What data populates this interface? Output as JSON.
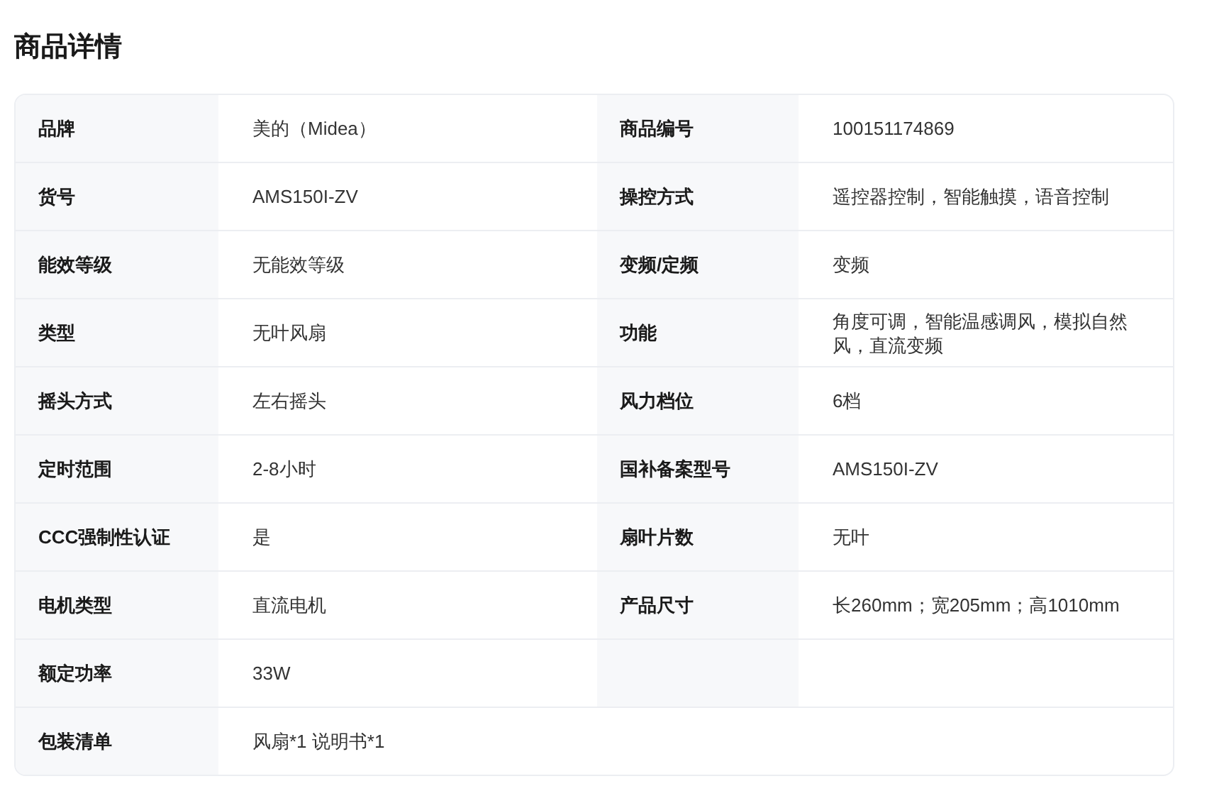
{
  "title": "商品详情",
  "rows": [
    {
      "kind": "double",
      "items": [
        {
          "label": "品牌",
          "value": "美的（Midea）"
        },
        {
          "label": "商品编号",
          "value": "100151174869"
        }
      ]
    },
    {
      "kind": "double",
      "items": [
        {
          "label": "货号",
          "value": "AMS150I-ZV"
        },
        {
          "label": "操控方式",
          "value": "遥控器控制，智能触摸，语音控制"
        }
      ]
    },
    {
      "kind": "double",
      "items": [
        {
          "label": "能效等级",
          "value": "无能效等级"
        },
        {
          "label": "变频/定频",
          "value": "变频"
        }
      ]
    },
    {
      "kind": "double",
      "items": [
        {
          "label": "类型",
          "value": "无叶风扇"
        },
        {
          "label": "功能",
          "value": "角度可调，智能温感调风，模拟自然风，直流变频"
        }
      ]
    },
    {
      "kind": "double",
      "items": [
        {
          "label": "摇头方式",
          "value": "左右摇头"
        },
        {
          "label": "风力档位",
          "value": "6档"
        }
      ]
    },
    {
      "kind": "double",
      "items": [
        {
          "label": "定时范围",
          "value": "2-8小时"
        },
        {
          "label": "国补备案型号",
          "value": "AMS150I-ZV"
        }
      ]
    },
    {
      "kind": "double",
      "items": [
        {
          "label": "CCC强制性认证",
          "value": "是"
        },
        {
          "label": "扇叶片数",
          "value": "无叶"
        }
      ]
    },
    {
      "kind": "double",
      "items": [
        {
          "label": "电机类型",
          "value": "直流电机"
        },
        {
          "label": "产品尺寸",
          "value": "长260mm；宽205mm；高1010mm"
        }
      ]
    },
    {
      "kind": "single",
      "items": [
        {
          "label": "额定功率",
          "value": "33W"
        }
      ]
    },
    {
      "kind": "wide",
      "items": [
        {
          "label": "包装清单",
          "value": "风扇*1 说明书*1"
        }
      ]
    }
  ]
}
